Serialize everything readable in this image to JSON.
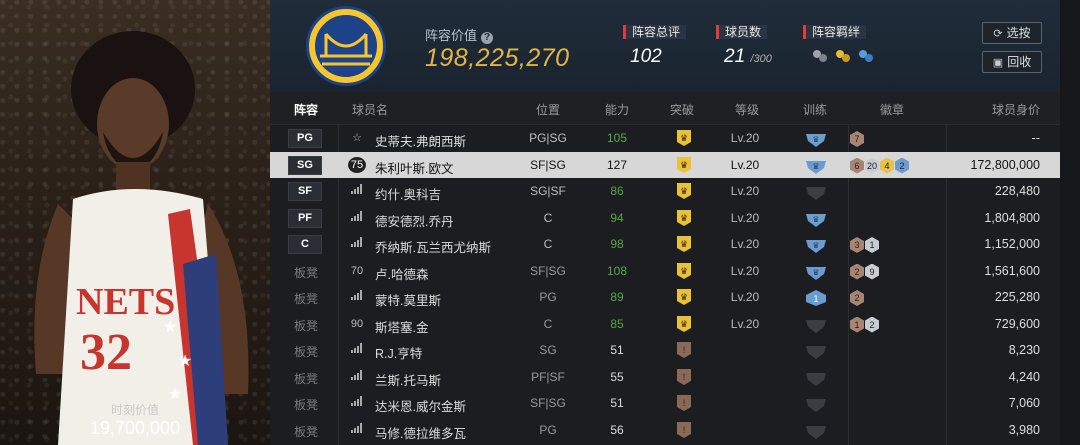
{
  "player_card": {
    "value_label": "时刻价值",
    "value": "19,700,000",
    "jersey_text": "NETS",
    "jersey_number": "32"
  },
  "header": {
    "lineup_value_label": "阵容价值",
    "lineup_value": "198,225,270",
    "total_rating_label": "阵容总评",
    "total_rating": "102",
    "player_count_label": "球员数",
    "player_count": "21",
    "player_count_max": "/300",
    "bond_label": "阵容羁绊",
    "select_button": "选按",
    "recycle_button": "回收"
  },
  "table": {
    "columns": {
      "lineup": "阵容",
      "name": "球员名",
      "position": "位置",
      "ability": "能力",
      "breakthrough": "突破",
      "level": "等级",
      "training": "训练",
      "badges": "徽章",
      "value": "球员身价"
    },
    "rows": [
      {
        "slot": "PG",
        "bench": "",
        "tier": "☆",
        "name": "史蒂夫.弗朗西斯",
        "position": "PG|SG",
        "ability": "105",
        "ovr_color": "green",
        "break_color": "gold",
        "level": "Lv.20",
        "train": "blue",
        "badges": [
          {
            "n": "7",
            "c": "bronze"
          }
        ],
        "value": "--"
      },
      {
        "slot": "SG",
        "bench": "",
        "tier": "75",
        "name": "朱利叶斯.欧文",
        "position": "SF|SG",
        "ability": "127",
        "ovr_color": "white",
        "break_color": "gold",
        "level": "Lv.20",
        "train": "blue",
        "badges": [
          {
            "n": "6",
            "c": "bronze"
          },
          {
            "n": "20",
            "c": "silver"
          },
          {
            "n": "4",
            "c": "gold"
          },
          {
            "n": "2",
            "c": "blue"
          }
        ],
        "value": "172,800,000",
        "selected": true
      },
      {
        "slot": "SF",
        "bench": "",
        "tier": "bars",
        "name": "约什.奥科吉",
        "position": "SG|SF",
        "ability": "86",
        "ovr_color": "green",
        "break_color": "gold",
        "level": "Lv.20",
        "train": "gray",
        "badges": [],
        "value": "228,480"
      },
      {
        "slot": "PF",
        "bench": "",
        "tier": "bars",
        "name": "德安德烈.乔丹",
        "position": "C",
        "ability": "94",
        "ovr_color": "green",
        "break_color": "gold",
        "level": "Lv.20",
        "train": "blue",
        "badges": [],
        "value": "1,804,800"
      },
      {
        "slot": "C",
        "bench": "",
        "tier": "bars",
        "name": "乔纳斯.瓦兰西尤纳斯",
        "position": "C",
        "ability": "98",
        "ovr_color": "green",
        "break_color": "gold",
        "level": "Lv.20",
        "train": "blue",
        "badges": [
          {
            "n": "3",
            "c": "bronze"
          },
          {
            "n": "1",
            "c": "silver"
          }
        ],
        "value": "1,152,000"
      },
      {
        "slot": "",
        "bench": "板凳",
        "tier": "70",
        "name": "卢.哈德森",
        "position": "SF|SG",
        "ability": "108",
        "ovr_color": "green",
        "break_color": "gold",
        "level": "Lv.20",
        "train": "blue",
        "badges": [
          {
            "n": "2",
            "c": "bronze"
          },
          {
            "n": "9",
            "c": "silver"
          }
        ],
        "value": "1,561,600"
      },
      {
        "slot": "",
        "bench": "板凳",
        "tier": "bars",
        "name": "蒙特.莫里斯",
        "position": "PG",
        "ability": "89",
        "ovr_color": "green",
        "break_color": "gold",
        "level": "Lv.20",
        "train": "blue1",
        "badges": [
          {
            "n": "2",
            "c": "bronze"
          }
        ],
        "value": "225,280"
      },
      {
        "slot": "",
        "bench": "板凳",
        "tier": "90",
        "name": "斯塔塞.金",
        "position": "C",
        "ability": "85",
        "ovr_color": "green",
        "break_color": "gold",
        "level": "Lv.20",
        "train": "gray",
        "badges": [
          {
            "n": "1",
            "c": "bronze"
          },
          {
            "n": "2",
            "c": "silver"
          }
        ],
        "value": "729,600"
      },
      {
        "slot": "",
        "bench": "板凳",
        "tier": "bars",
        "name": "R.J.亨特",
        "position": "SG",
        "ability": "51",
        "ovr_color": "white",
        "break_color": "bronze",
        "level": "",
        "train": "gray",
        "badges": [],
        "value": "8,230"
      },
      {
        "slot": "",
        "bench": "板凳",
        "tier": "bars",
        "name": "兰斯.托马斯",
        "position": "PF|SF",
        "ability": "55",
        "ovr_color": "white",
        "break_color": "bronze",
        "level": "",
        "train": "gray",
        "badges": [],
        "value": "4,240"
      },
      {
        "slot": "",
        "bench": "板凳",
        "tier": "bars",
        "name": "达米恩.威尔金斯",
        "position": "SF|SG",
        "ability": "51",
        "ovr_color": "white",
        "break_color": "bronze",
        "level": "",
        "train": "gray",
        "badges": [],
        "value": "7,060"
      },
      {
        "slot": "",
        "bench": "板凳",
        "tier": "bars",
        "name": "马修.德拉维多瓦",
        "position": "PG",
        "ability": "56",
        "ovr_color": "white",
        "break_color": "bronze",
        "level": "",
        "train": "gray",
        "badges": [],
        "value": "3,980"
      }
    ]
  },
  "colors": {
    "accent_gold": "#e2b544",
    "ability_green": "#5aa546",
    "label_red": "#e33a3a",
    "train_blue": "#6a9ccf",
    "break_gold": "#e9c23a",
    "break_bronze": "#8a6a57"
  }
}
